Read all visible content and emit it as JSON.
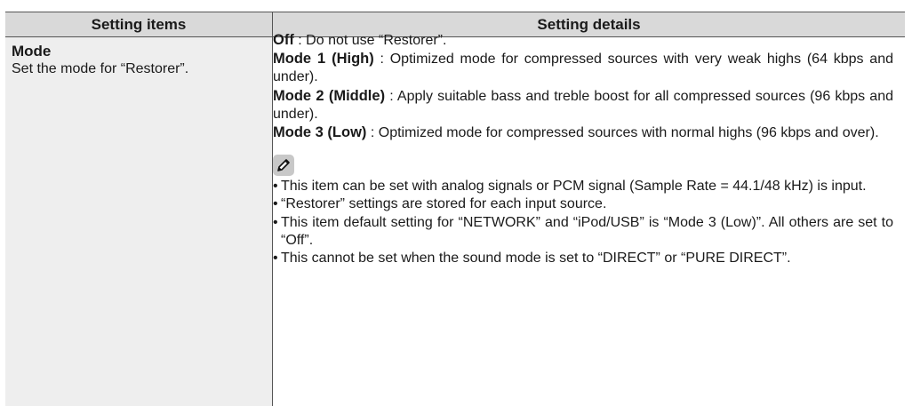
{
  "header": {
    "col1": "Setting items",
    "col2": "Setting details"
  },
  "item": {
    "title": "Mode",
    "description": "Set the mode for “Restorer”."
  },
  "details": [
    {
      "label": "Off",
      "text": " : Do not use “Restorer”."
    },
    {
      "label": "Mode 1 (High)",
      "text": " : Optimized mode for compressed sources with very weak highs (64 kbps and under)."
    },
    {
      "label": "Mode 2 (Middle)",
      "text": " : Apply suitable bass and treble boost for all compressed sources (96 kbps and under)."
    },
    {
      "label": "Mode 3 (Low)",
      "text": " : Optimized mode for compressed sources with normal highs (96 kbps and over)."
    }
  ],
  "note_icon": "pencil-icon",
  "notes": [
    "This item can be set with analog signals or PCM signal (Sample Rate = 44.1/48 kHz) is input.",
    "“Restorer” settings are stored for each input source.",
    "This item default setting for “NETWORK” and “iPod/USB” is “Mode 3 (Low)”. All others are set to “Off”.",
    "This cannot be set when the sound mode is set to “DIRECT” or “PURE DIRECT”."
  ]
}
